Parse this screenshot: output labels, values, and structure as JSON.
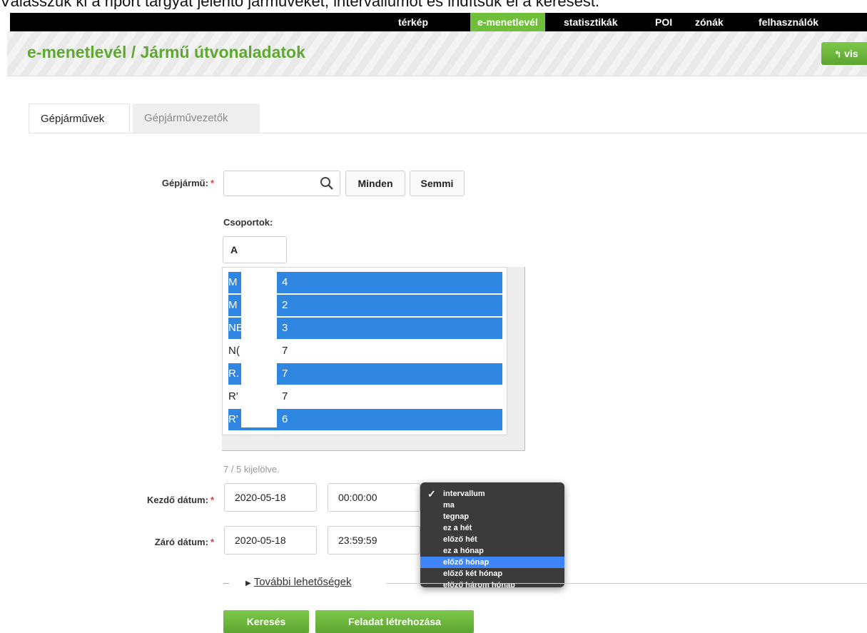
{
  "instruction": "Válasszuk ki a riport tárgyát jelentő járműveket, intervallumot és indítsuk el a keresést.",
  "nav": {
    "items": [
      "térkép",
      "e-menetlevél",
      "statisztikák",
      "POI",
      "zónák",
      "felhasználók"
    ],
    "active": "e-menetlevél",
    "active_color": "#6fbf3a"
  },
  "header": {
    "title": "e-menetlevél / Jármű útvonaladatok",
    "back_label": "vis",
    "title_color": "#5fa832"
  },
  "tabs": [
    "Gépjárművek",
    "Gépjárművezetők"
  ],
  "vehicle": {
    "label": "Gépjármű:",
    "required_mark": "*",
    "search_value": "",
    "all_label": "Minden",
    "none_label": "Semmi"
  },
  "groups": {
    "label": "Csoportok:",
    "filter_value": "A"
  },
  "vehicle_list": [
    {
      "prefix": "M",
      "suffix": "4",
      "selected": true
    },
    {
      "prefix": "M",
      "suffix": "2",
      "selected": true
    },
    {
      "prefix": "NE",
      "suffix": "3",
      "selected": true
    },
    {
      "prefix": "N(",
      "suffix": "7",
      "selected": false
    },
    {
      "prefix": "R.",
      "suffix": "7",
      "selected": true
    },
    {
      "prefix": "R'",
      "suffix": "7",
      "selected": false
    },
    {
      "prefix": "R'",
      "suffix": "6",
      "selected": true
    }
  ],
  "selection_color": "#2f86e0",
  "selected_count": "7 / 5 kijelölve.",
  "start": {
    "label": "Kezdő dátum:",
    "date": "2020-05-18",
    "time": "00:00:00"
  },
  "end": {
    "label": "Záró dátum:",
    "date": "2020-05-18",
    "time": "23:59:59"
  },
  "interval_dropdown": {
    "options": [
      "intervallum",
      "ma",
      "tegnap",
      "ez a hét",
      "előző hét",
      "ez a hónap",
      "előző hónap",
      "előző két hónap",
      "előző három hónap"
    ],
    "checked": "intervallum",
    "highlighted": "előző hónap"
  },
  "more_options": "További lehetőségek",
  "buttons": {
    "search": "Keresés",
    "create_task": "Feladat létrehozása"
  }
}
